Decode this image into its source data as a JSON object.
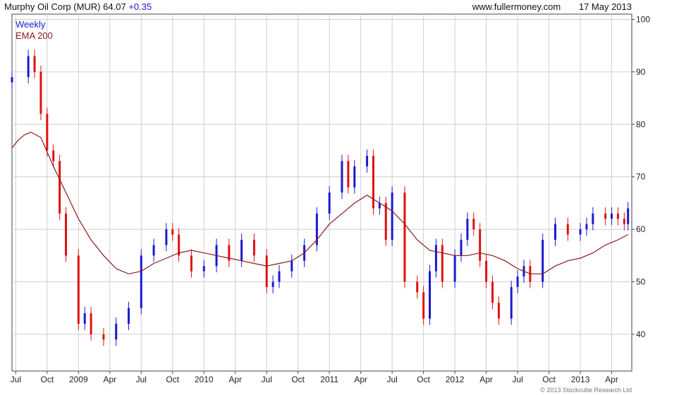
{
  "header": {
    "symbol": "Murphy Oil Corp (MUR)",
    "price": "64.07",
    "change": "+0.35",
    "source": "www.fullermoney.com",
    "date": "17 May 2013"
  },
  "legend": {
    "weekly": "Weekly",
    "ema": "EMA 200"
  },
  "copyright": "© 2013 Stockcube Research Ltd",
  "colors": {
    "up": "#1a1acc",
    "down": "#e01010",
    "ema": "#8b1a1a",
    "grid": "#cfcfcf"
  },
  "chart_data": {
    "type": "line",
    "ylim": [
      33,
      101
    ],
    "xlim": [
      2008.47,
      2013.41
    ],
    "y_ticks": [
      40,
      50,
      60,
      70,
      80,
      90,
      100
    ],
    "x_ticks": [
      {
        "label": "Jul",
        "x": 2008.5
      },
      {
        "label": "Oct",
        "x": 2008.75
      },
      {
        "label": "2009",
        "x": 2009.0
      },
      {
        "label": "Apr",
        "x": 2009.25
      },
      {
        "label": "Jul",
        "x": 2009.5
      },
      {
        "label": "Oct",
        "x": 2009.75
      },
      {
        "label": "2010",
        "x": 2010.0
      },
      {
        "label": "Apr",
        "x": 2010.25
      },
      {
        "label": "Jul",
        "x": 2010.5
      },
      {
        "label": "Oct",
        "x": 2010.75
      },
      {
        "label": "2011",
        "x": 2011.0
      },
      {
        "label": "Apr",
        "x": 2011.25
      },
      {
        "label": "Jul",
        "x": 2011.5
      },
      {
        "label": "Oct",
        "x": 2011.75
      },
      {
        "label": "2012",
        "x": 2012.0
      },
      {
        "label": "Apr",
        "x": 2012.25
      },
      {
        "label": "Jul",
        "x": 2012.5
      },
      {
        "label": "Oct",
        "x": 2012.75
      },
      {
        "label": "2013",
        "x": 2013.0
      },
      {
        "label": "Apr",
        "x": 2013.25
      }
    ],
    "grid": true,
    "series": [
      {
        "name": "Weekly",
        "style": "candlestick",
        "x": [
          2008.47,
          2008.6,
          2008.65,
          2008.7,
          2008.75,
          2008.8,
          2008.85,
          2008.9,
          2009.0,
          2009.05,
          2009.1,
          2009.2,
          2009.3,
          2009.4,
          2009.5,
          2009.6,
          2009.7,
          2009.75,
          2009.8,
          2009.9,
          2010.0,
          2010.1,
          2010.2,
          2010.3,
          2010.4,
          2010.5,
          2010.55,
          2010.6,
          2010.7,
          2010.8,
          2010.9,
          2011.0,
          2011.1,
          2011.15,
          2011.2,
          2011.3,
          2011.35,
          2011.4,
          2011.45,
          2011.5,
          2011.6,
          2011.7,
          2011.75,
          2011.8,
          2011.85,
          2011.9,
          2012.0,
          2012.05,
          2012.1,
          2012.15,
          2012.2,
          2012.25,
          2012.3,
          2012.35,
          2012.45,
          2012.5,
          2012.55,
          2012.6,
          2012.7,
          2012.8,
          2012.9,
          2013.0,
          2013.05,
          2013.1,
          2013.2,
          2013.25,
          2013.3,
          2013.35,
          2013.38
        ],
        "values": [
          89,
          93,
          90,
          82,
          75,
          73,
          63,
          55,
          42,
          44,
          40,
          39,
          42,
          45,
          55,
          57,
          60,
          59,
          55,
          52,
          53,
          57,
          54,
          58,
          55,
          49,
          50,
          52,
          54,
          57,
          63,
          67,
          73,
          68,
          72,
          74,
          64,
          65,
          58,
          67,
          50,
          48,
          43,
          52,
          57,
          50,
          55,
          58,
          62,
          60,
          54,
          50,
          46,
          43,
          49,
          51,
          53,
          50,
          58,
          61,
          59,
          60,
          61,
          63,
          62,
          63,
          62,
          61,
          64
        ]
      },
      {
        "name": "EMA 200",
        "style": "line",
        "x": [
          2008.47,
          2008.52,
          2008.57,
          2008.62,
          2008.7,
          2008.8,
          2008.9,
          2009.0,
          2009.1,
          2009.2,
          2009.3,
          2009.4,
          2009.5,
          2009.6,
          2009.7,
          2009.8,
          2009.9,
          2010.0,
          2010.1,
          2010.2,
          2010.3,
          2010.4,
          2010.5,
          2010.6,
          2010.7,
          2010.8,
          2010.9,
          2011.0,
          2011.1,
          2011.2,
          2011.3,
          2011.4,
          2011.5,
          2011.6,
          2011.7,
          2011.8,
          2011.9,
          2012.0,
          2012.1,
          2012.2,
          2012.3,
          2012.4,
          2012.5,
          2012.6,
          2012.7,
          2012.8,
          2012.9,
          2013.0,
          2013.1,
          2013.2,
          2013.3,
          2013.38
        ],
        "values": [
          75.5,
          77,
          78,
          78.5,
          77.5,
          72,
          67,
          62,
          58,
          55,
          52.5,
          51.5,
          52,
          53.5,
          54.5,
          55.5,
          56,
          55.5,
          55,
          54.5,
          54,
          53.5,
          53,
          53.5,
          54,
          55.5,
          58,
          61,
          63,
          65,
          66.5,
          65,
          63.5,
          61,
          58,
          56,
          55.5,
          55,
          55,
          55.5,
          55,
          54,
          52.5,
          51.5,
          51.5,
          53,
          54,
          54.5,
          55.5,
          57,
          58,
          59
        ]
      }
    ]
  }
}
